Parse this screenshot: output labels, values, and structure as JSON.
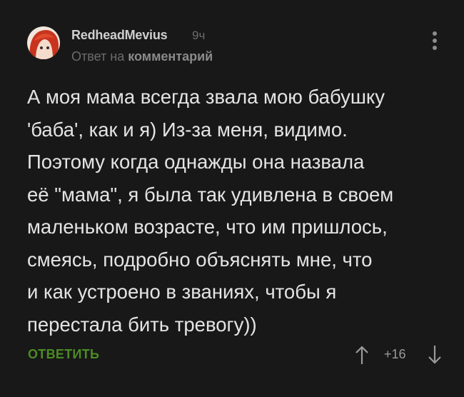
{
  "comment": {
    "avatar_icon": "avatar-image",
    "username": "RedheadMevius",
    "time": "9ч",
    "reply_prefix": "Ответ на ",
    "reply_link": "комментарий",
    "more_icon": "vertical-ellipsis-icon",
    "text": "А моя мама всегда звала мою бабушку\n'баба', как и я) Из-за меня, видимо.\nПоэтому когда однажды она назвала\nеё \"мама\", я была так удивлена в своем\nмаленьком возрасте, что им пришлось,\nсмеясь, подробно объяснять мне, что\nи как устроено в званиях, чтобы я\nперестала бить тревогу))",
    "reply_label": "ОТВЕТИТЬ",
    "score": "+16",
    "upvote_icon": "arrow-up-icon",
    "downvote_icon": "arrow-down-icon"
  },
  "colors": {
    "background": "#181818",
    "text": "#e4e4e4",
    "muted": "#6c6c6c",
    "accent_green": "#4c8b23"
  }
}
